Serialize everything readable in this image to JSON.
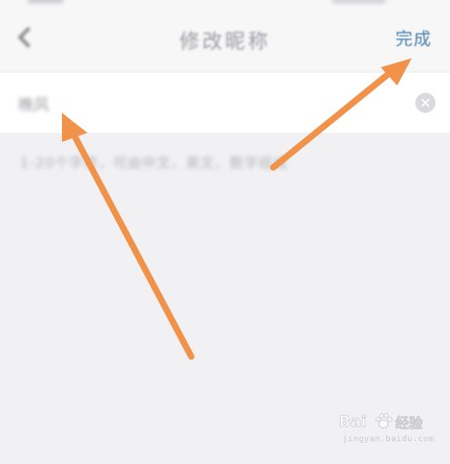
{
  "nav": {
    "title": "修改昵称",
    "done_label": "完成",
    "back_icon": "chevron-left-icon"
  },
  "nickname": {
    "value": "晚风",
    "clear_icon": "clear-circle-icon"
  },
  "hint": {
    "text": "1-20个字符，可由中文、英文、数字组成"
  },
  "annotations": {
    "arrow_color": "#f0924a",
    "arrows": [
      {
        "from": "bottom-left",
        "to": "nickname-input"
      },
      {
        "from": "center",
        "to": "done-button"
      }
    ]
  },
  "watermark": {
    "brand": "Bai",
    "brand_suffix": "经验",
    "url": "jingyan.baidu.com"
  },
  "colors": {
    "background": "#f1f1f3",
    "nav_background": "#f7f7f8",
    "input_background": "#ffffff",
    "done_color": "#4a7fa8",
    "arrow": "#f0924a"
  }
}
